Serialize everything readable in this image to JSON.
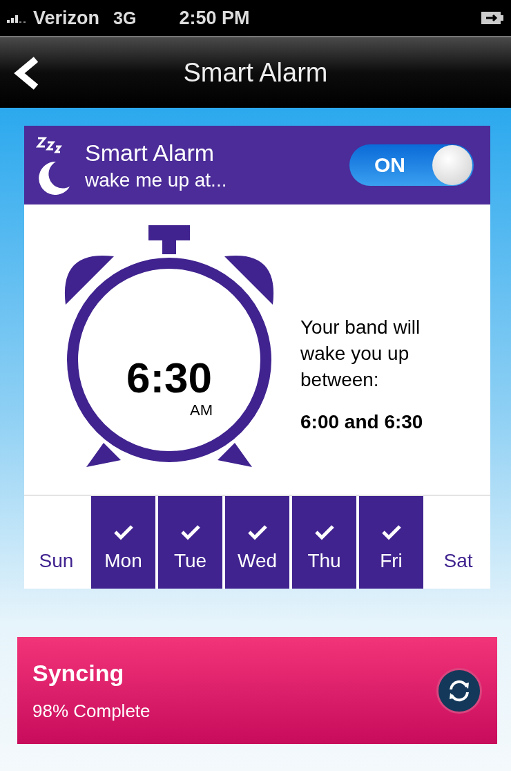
{
  "status_bar": {
    "carrier": "Verizon",
    "network": "3G",
    "time": "2:50 PM"
  },
  "nav_bar": {
    "title": "Smart Alarm"
  },
  "alarm_card": {
    "title": "Smart Alarm",
    "subtitle": "wake me up at...",
    "toggle": {
      "label": "ON",
      "on": true
    },
    "time": "6:30",
    "meridiem": "AM",
    "description": "Your band will wake you up between:",
    "window": "6:00 and 6:30",
    "days": [
      {
        "label": "Sun",
        "checked": false
      },
      {
        "label": "Mon",
        "checked": true
      },
      {
        "label": "Tue",
        "checked": true
      },
      {
        "label": "Wed",
        "checked": true
      },
      {
        "label": "Thu",
        "checked": true
      },
      {
        "label": "Fri",
        "checked": true
      },
      {
        "label": "Sat",
        "checked": false
      }
    ]
  },
  "sync_panel": {
    "title": "Syncing",
    "status": "98% Complete"
  }
}
